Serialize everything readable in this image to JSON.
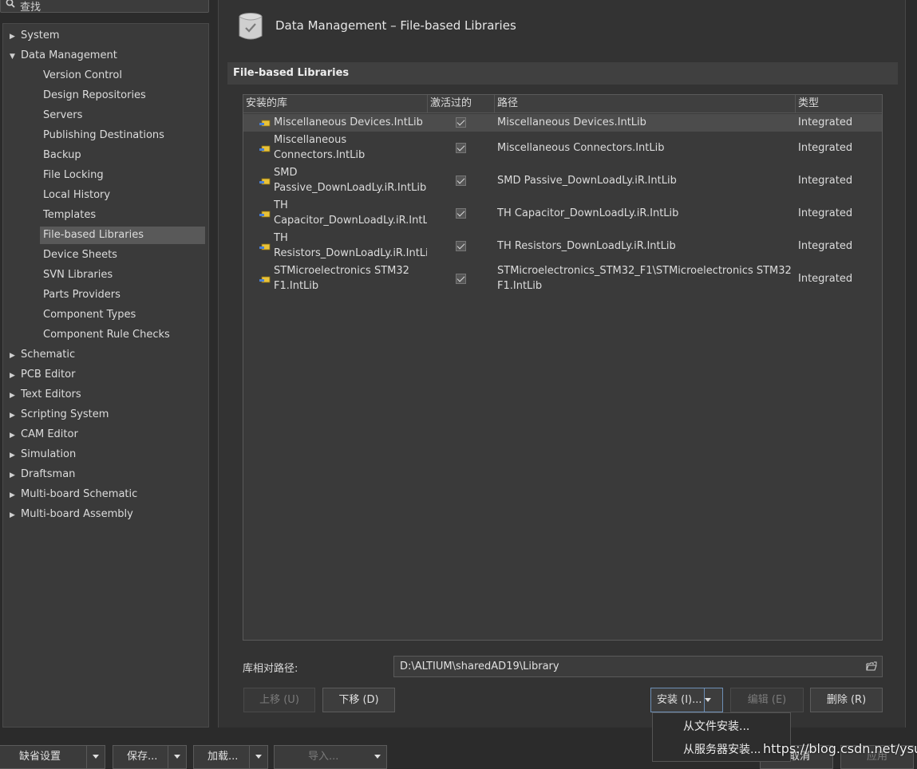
{
  "search": {
    "placeholder": "查找"
  },
  "tree": {
    "top_items": [
      {
        "label": "System",
        "expanded": false
      },
      {
        "label": "Data Management",
        "expanded": true
      }
    ],
    "data_management_children": [
      "Version Control",
      "Design Repositories",
      "Servers",
      "Publishing Destinations",
      "Backup",
      "File Locking",
      "Local History",
      "Templates",
      "File-based Libraries",
      "Device Sheets",
      "SVN Libraries",
      "Parts Providers",
      "Component Types",
      "Component Rule Checks"
    ],
    "selected": "File-based Libraries",
    "other_items": [
      "Schematic",
      "PCB Editor",
      "Text Editors",
      "Scripting System",
      "CAM Editor",
      "Simulation",
      "Draftsman",
      "Multi-board Schematic",
      "Multi-board Assembly"
    ]
  },
  "page": {
    "title": "Data Management – File-based Libraries",
    "section": "File-based Libraries"
  },
  "table": {
    "columns": [
      "安装的库",
      "激活过的",
      "路径",
      "类型"
    ],
    "rows": [
      {
        "name": [
          "Miscellaneous Devices.IntLib"
        ],
        "active": true,
        "path": [
          "Miscellaneous Devices.IntLib"
        ],
        "type": "Integrated"
      },
      {
        "name": [
          "Miscellaneous",
          "Connectors.IntLib"
        ],
        "active": true,
        "path": [
          "Miscellaneous Connectors.IntLib"
        ],
        "type": "Integrated"
      },
      {
        "name": [
          "SMD",
          "Passive_DownLoadLy.iR.IntLib"
        ],
        "active": true,
        "path": [
          "SMD Passive_DownLoadLy.iR.IntLib"
        ],
        "type": "Integrated"
      },
      {
        "name": [
          "TH",
          "Capacitor_DownLoadLy.iR.IntLib"
        ],
        "active": true,
        "path": [
          "TH Capacitor_DownLoadLy.iR.IntLib"
        ],
        "type": "Integrated"
      },
      {
        "name": [
          "TH",
          "Resistors_DownLoadLy.iR.IntLib"
        ],
        "active": true,
        "path": [
          "TH Resistors_DownLoadLy.iR.IntLib"
        ],
        "type": "Integrated"
      },
      {
        "name": [
          "STMicroelectronics STM32",
          "F1.IntLib"
        ],
        "active": true,
        "path": [
          "STMicroelectronics_STM32_F1\\STMicroelectronics STM32",
          "F1.IntLib"
        ],
        "type": "Integrated"
      }
    ]
  },
  "relative_path": {
    "label": "库相对路径:",
    "value": "D:\\ALTIUM\\sharedAD19\\Library"
  },
  "buttons": {
    "move_up": "上移 (U)",
    "move_down": "下移 (D)",
    "install": "安装 (I)...",
    "edit": "编辑 (E)",
    "remove": "删除 (R)"
  },
  "install_menu": [
    "从文件安装...",
    "从服务器安装..."
  ],
  "bottom_bar": {
    "defaults": "缺省设置",
    "save": "保存...",
    "load": "加载...",
    "import": "导入...",
    "cancel": "取消",
    "apply": "应用"
  },
  "watermark": "https://blog.csdn.net/ysulz",
  "colors": {
    "background": "#2b2b2b",
    "panel": "#3a3a3a",
    "selected": "#595959",
    "accent": "#6d8fb6"
  }
}
